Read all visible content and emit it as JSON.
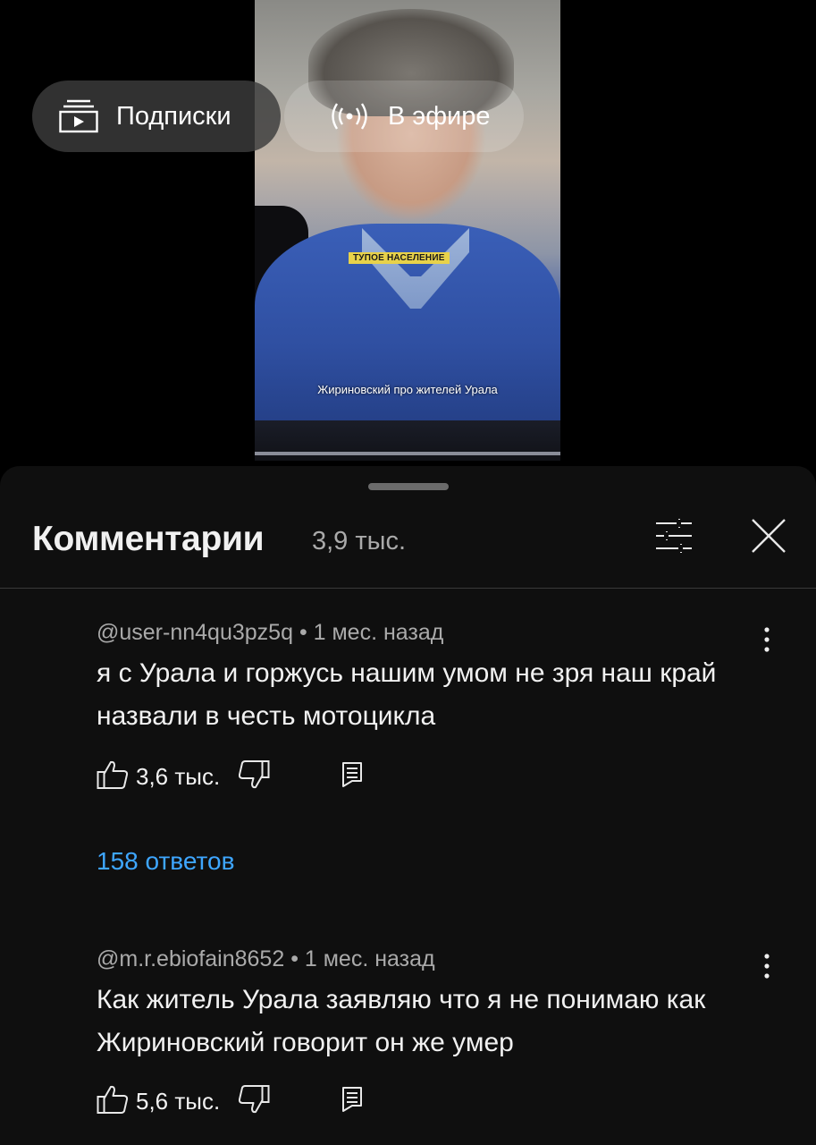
{
  "video": {
    "caption_overlay": "ТУПОЕ НАСЕЛЕНИЕ",
    "subtitle": "Жириновский про жителей Урала"
  },
  "top_chips": [
    {
      "label": "Подписки",
      "icon": "subscriptions-icon"
    },
    {
      "label": "В эфире",
      "icon": "live-broadcast-icon"
    }
  ],
  "comments_panel": {
    "title": "Комментарии",
    "count": "3,9 тыс.",
    "filter_icon": "sort-filter-icon",
    "close_icon": "close-icon"
  },
  "comments": [
    {
      "author": "@user-nn4qu3pz5q",
      "time": "1 мес. назад",
      "text": "я с Урала и горжусь нашим умом не зря наш край назвали в честь мотоцикла",
      "likes": "3,6 тыс.",
      "replies": "158 ответов"
    },
    {
      "author": "@m.r.ebiofain8652",
      "time": "1 мес. назад",
      "text": "Как житель Урала заявляю что я не понимаю как Жириновский говорит он же умер",
      "likes": "5,6 тыс."
    }
  ],
  "colors": {
    "sheet_background": "#0f0f0f",
    "link_blue": "#3ea6ff",
    "secondary_text": "#aaaaaa",
    "overlay_caption_bg": "#e8d24a"
  }
}
